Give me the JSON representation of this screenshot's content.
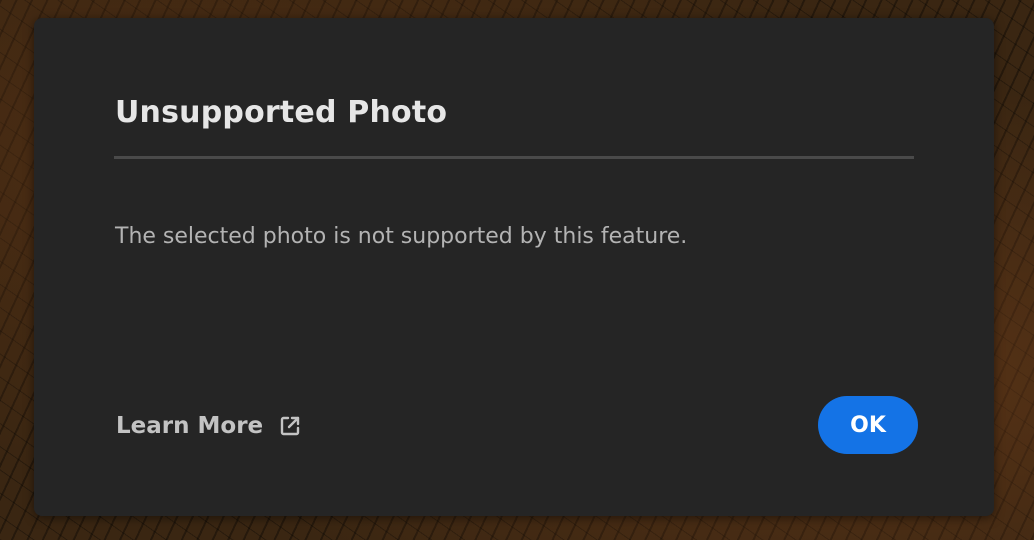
{
  "dialog": {
    "title": "Unsupported Photo",
    "message": "The selected photo is not supported by this feature.",
    "learn_more_label": "Learn More",
    "learn_more_icon": "external-link-icon",
    "ok_label": "OK"
  },
  "colors": {
    "dialog_background": "#252525",
    "title_text": "#e6e6e6",
    "body_text": "#b3b3b3",
    "primary_button": "#1473e6",
    "divider": "#4a4a4a"
  }
}
